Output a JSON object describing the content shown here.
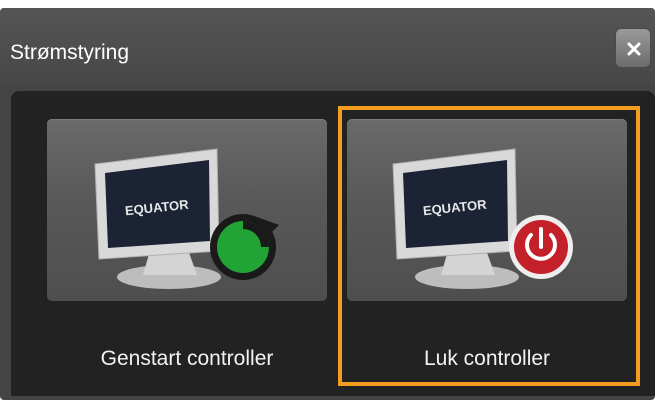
{
  "dialog": {
    "title": "Strømstyring",
    "close_icon": "close-icon"
  },
  "options": [
    {
      "label": "Genstart controller",
      "icon": "restart-controller-icon",
      "screen_text": "EQUATOR"
    },
    {
      "label": "Luk controller",
      "icon": "shutdown-controller-icon",
      "screen_text": "EQUATOR",
      "highlighted": true
    }
  ],
  "colors": {
    "title_bar": "#4f4f4f",
    "panel": "#222222",
    "tile": "#5e5e5e",
    "highlight": "#f39c1f",
    "restart_badge": "#22a335",
    "power_badge": "#c4202a"
  }
}
